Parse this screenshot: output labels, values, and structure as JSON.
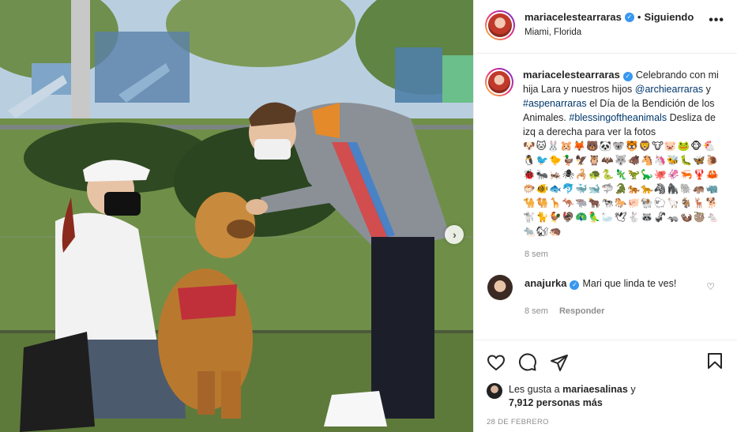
{
  "header": {
    "username": "mariacelestearraras",
    "separator": "•",
    "follow_status": "Siguiendo",
    "location": "Miami, Florida",
    "more_label": "•••"
  },
  "caption": {
    "username": "mariacelestearraras",
    "text_1": "Celebrando con mi hija Lara y nuestros hijos",
    "mention_1": "@archiearraras",
    "text_2": "y",
    "mention_2": "#aspenarraras",
    "text_3": "el Día de la Bendición de los Animales.",
    "hashtag": "#blessingoftheanimals",
    "text_4": "Desliza de izq a derecha para ver la fotos",
    "emojis": "🐶🐱🐰🐹🦊🐻🐼🐨🐯🦁🐮🐷🐸🐵🐔🐧🐦🐤🦆🦅🦉🦇🐺🐗🐴🦄🐝🐛🦋🐌🐞🐜🦗🕷🦂🐢🐍🦎🦖🦕🐙🦑🦐🦞🦀🐡🐠🐟🐬🐳🐋🦈🐊🐅🐆🦓🦍🐘🦛🦏🐪🐫🦒🦘🐃🐂🐄🐎🐖🐏🐑🦙🐐🦌🐕🐩🐈🐓🦃🦚🦜🦢🕊🐇🦝🦨🦡🦦🦥🐁🐀🐿🦔",
    "time": "8 sem"
  },
  "comment": {
    "username": "anajurka",
    "text": "Mari que linda te ves!",
    "time": "8 sem",
    "reply_label": "Responder"
  },
  "likes": {
    "prefix": "Les gusta a",
    "user": "mariaesalinas",
    "middle": "y",
    "count": "7,912 personas más"
  },
  "date": "28 DE FEBRERO",
  "icons": {
    "heart": "heart-icon",
    "comment": "comment-icon",
    "share": "share-icon",
    "save": "bookmark-icon",
    "next": "chevron-right-icon",
    "verified": "verified-badge-icon"
  },
  "colors": {
    "link": "#00376b",
    "verified": "#3897f0",
    "meta": "#8e8e8e"
  }
}
